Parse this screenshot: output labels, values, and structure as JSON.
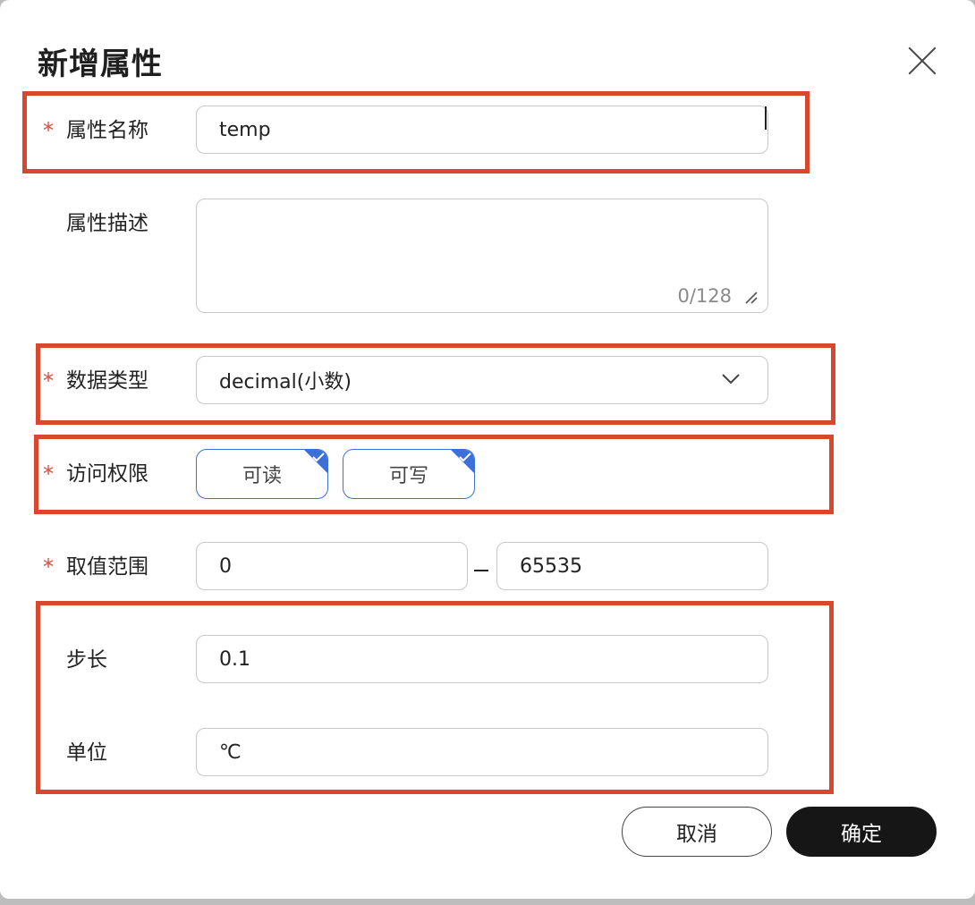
{
  "dialog": {
    "title": "新增属性",
    "close_icon": "close-icon"
  },
  "form": {
    "required_mark": "*",
    "name": {
      "label": "属性名称",
      "value": "temp"
    },
    "description": {
      "label": "属性描述",
      "value": "",
      "counter": "0/128"
    },
    "data_type": {
      "label": "数据类型",
      "value": "decimal(小数)"
    },
    "access": {
      "label": "访问权限",
      "options": [
        {
          "label": "可读",
          "checked": true
        },
        {
          "label": "可写",
          "checked": true
        }
      ]
    },
    "range": {
      "label": "取值范围",
      "min": "0",
      "max": "65535"
    },
    "step": {
      "label": "步长",
      "value": "0.1"
    },
    "unit": {
      "label": "单位",
      "value": "℃"
    }
  },
  "footer": {
    "cancel_label": "取消",
    "confirm_label": "确定"
  },
  "colors": {
    "highlight": "#d9482e",
    "accent": "#3d6fd8",
    "required": "#e04b3c",
    "primary_button": "#161616"
  }
}
